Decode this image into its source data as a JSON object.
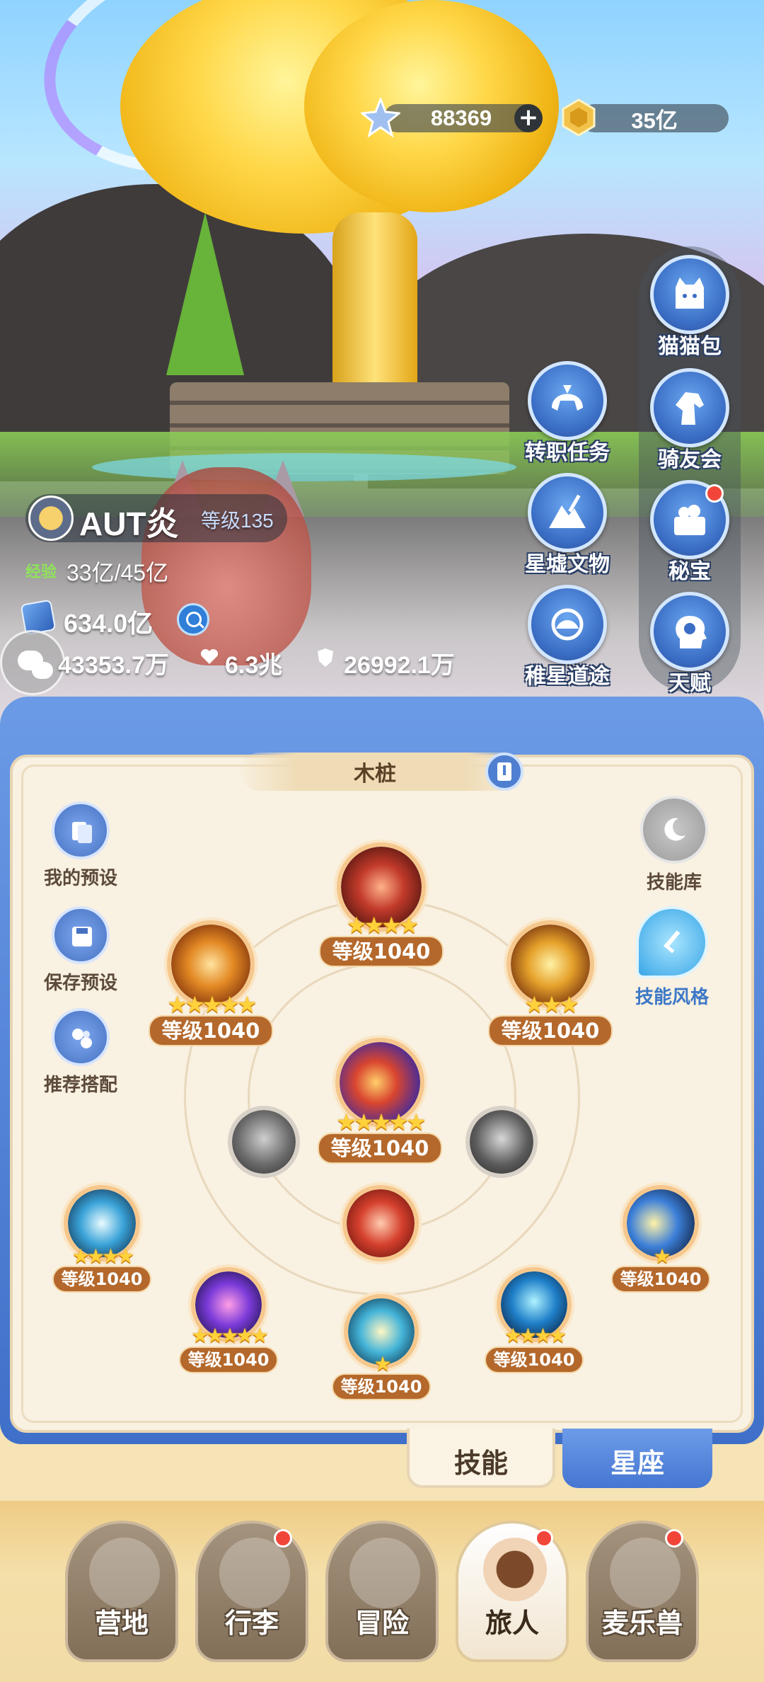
{
  "currency": {
    "gems": "88369",
    "gold": "35亿"
  },
  "player": {
    "name": "AUT炎",
    "level": "等级135",
    "exp_label": "经验",
    "exp_value": "33亿/45亿",
    "power": "634.0亿",
    "attack": "43353.7万",
    "hp": "6.3兆",
    "defense": "26992.1万"
  },
  "side_menu": [
    {
      "label": "猫猫包",
      "icon": "cat-bag-icon",
      "badge": false
    },
    {
      "label": "骑友会",
      "icon": "horse-head-icon",
      "badge": false
    },
    {
      "label": "秘宝",
      "icon": "treasure-chest-icon",
      "badge": true
    },
    {
      "label": "天赋",
      "icon": "head-brain-icon",
      "badge": false
    },
    {
      "label": "转职任务",
      "icon": "helmet-icon",
      "badge": false
    },
    {
      "label": "星墟文物",
      "icon": "mountain-sword-icon",
      "badge": false
    },
    {
      "label": "稚星道途",
      "icon": "star-road-icon",
      "badge": false
    }
  ],
  "panel": {
    "target": "木桩",
    "left_buttons": [
      {
        "label": "我的预设",
        "icon": "preset-cards-icon"
      },
      {
        "label": "保存预设",
        "icon": "save-disk-icon"
      },
      {
        "label": "推荐搭配",
        "icon": "recommend-combo-icon"
      }
    ],
    "right_buttons": [
      {
        "label": "技能库",
        "icon": "moon-star-icon"
      },
      {
        "label": "技能风格",
        "icon": "sword-shield-icon"
      }
    ],
    "skills": [
      {
        "id": "top",
        "level": "等级1040",
        "stars": "★★★★"
      },
      {
        "id": "upper-left",
        "level": "等级1040",
        "stars": "★★★★★"
      },
      {
        "id": "upper-right",
        "level": "等级1040",
        "stars": "★★★"
      },
      {
        "id": "center",
        "level": "等级1040",
        "stars": "★★★★★"
      },
      {
        "id": "far-left",
        "level": "等级1040",
        "stars": "★★★★"
      },
      {
        "id": "far-right",
        "level": "等级1040",
        "stars": "★"
      },
      {
        "id": "lower-left",
        "level": "等级1040",
        "stars": "★★★★★"
      },
      {
        "id": "lower-center",
        "level": "等级1040",
        "stars": "★"
      },
      {
        "id": "lower-right",
        "level": "等级1040",
        "stars": "★★★★"
      }
    ]
  },
  "tabs": {
    "skill": "技能",
    "constellation": "星座"
  },
  "bottom_nav": [
    {
      "label": "营地",
      "badge": false,
      "active": false
    },
    {
      "label": "行李",
      "badge": true,
      "active": false
    },
    {
      "label": "冒险",
      "badge": false,
      "active": false
    },
    {
      "label": "旅人",
      "badge": true,
      "active": true
    },
    {
      "label": "麦乐兽",
      "badge": true,
      "active": false
    }
  ],
  "colors": {
    "panel_blue": "#4f7fd0",
    "level_brown": "#b4682b",
    "badge_red": "#f2453a",
    "exp_green": "#8fe35a"
  }
}
